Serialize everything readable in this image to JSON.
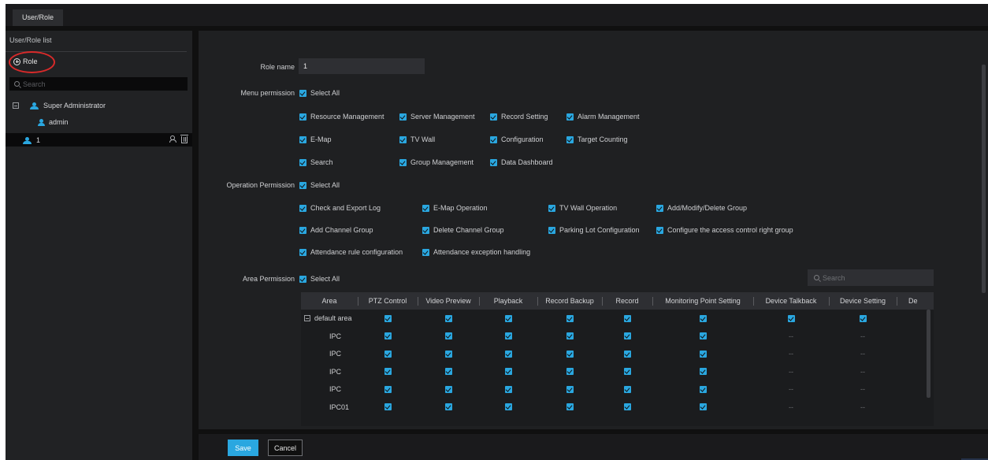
{
  "tab": {
    "label": "User/Role"
  },
  "sidebar": {
    "title": "User/Role list",
    "add_role_label": "Role",
    "search_placeholder": "Search",
    "tree": [
      {
        "label": "Super Administrator",
        "icon": "people-icon"
      },
      {
        "label": "admin",
        "icon": "person-icon"
      },
      {
        "label": "1",
        "icon": "people-icon",
        "selected": true
      }
    ]
  },
  "form": {
    "role_name_label": "Role name",
    "role_name_value": "1",
    "menu_permission_label": "Menu permission",
    "operation_permission_label": "Operation Permission",
    "area_permission_label": "Area Permission",
    "select_all_label": "Select All",
    "menu_items": [
      "Resource Management",
      "Server Management",
      "Record Setting",
      "Alarm Management",
      "E-Map",
      "TV Wall",
      "Configuration",
      "Target Counting",
      "Search",
      "Group Management",
      "Data Dashboard"
    ],
    "operation_items": [
      "Check and Export Log",
      "E-Map Operation",
      "TV Wall Operation",
      "Add/Modify/Delete Group",
      "Add Channel Group",
      "Delete Channel Group",
      "Parking Lot Configuration",
      "Configure the access control right group",
      "Attendance rule configuration",
      "Attendance exception handling"
    ]
  },
  "area_table": {
    "search_placeholder": "Search",
    "columns": [
      "Area",
      "PTZ Control",
      "Video Preview",
      "Playback",
      "Record Backup",
      "Record",
      "Monitoring Point Setting",
      "Device Talkback",
      "Device Setting",
      "De"
    ],
    "rows": [
      {
        "name": "default area",
        "group": true,
        "cells": [
          "check",
          "check",
          "check",
          "check",
          "check",
          "check",
          "check",
          "check"
        ]
      },
      {
        "name": "IPC",
        "cells": [
          "check",
          "check",
          "check",
          "check",
          "check",
          "check",
          "--",
          "--"
        ]
      },
      {
        "name": "IPC",
        "cells": [
          "check",
          "check",
          "check",
          "check",
          "check",
          "check",
          "--",
          "--"
        ]
      },
      {
        "name": "IPC",
        "cells": [
          "check",
          "check",
          "check",
          "check",
          "check",
          "check",
          "--",
          "--"
        ]
      },
      {
        "name": "IPC",
        "cells": [
          "check",
          "check",
          "check",
          "check",
          "check",
          "check",
          "--",
          "--"
        ]
      },
      {
        "name": "IPC01",
        "cells": [
          "check",
          "check",
          "check",
          "check",
          "check",
          "check",
          "--",
          "--"
        ]
      }
    ]
  },
  "footer": {
    "save_label": "Save",
    "cancel_label": "Cancel"
  },
  "colors": {
    "accent": "#2aa7e0",
    "annotation_ring": "#d92a2a"
  }
}
